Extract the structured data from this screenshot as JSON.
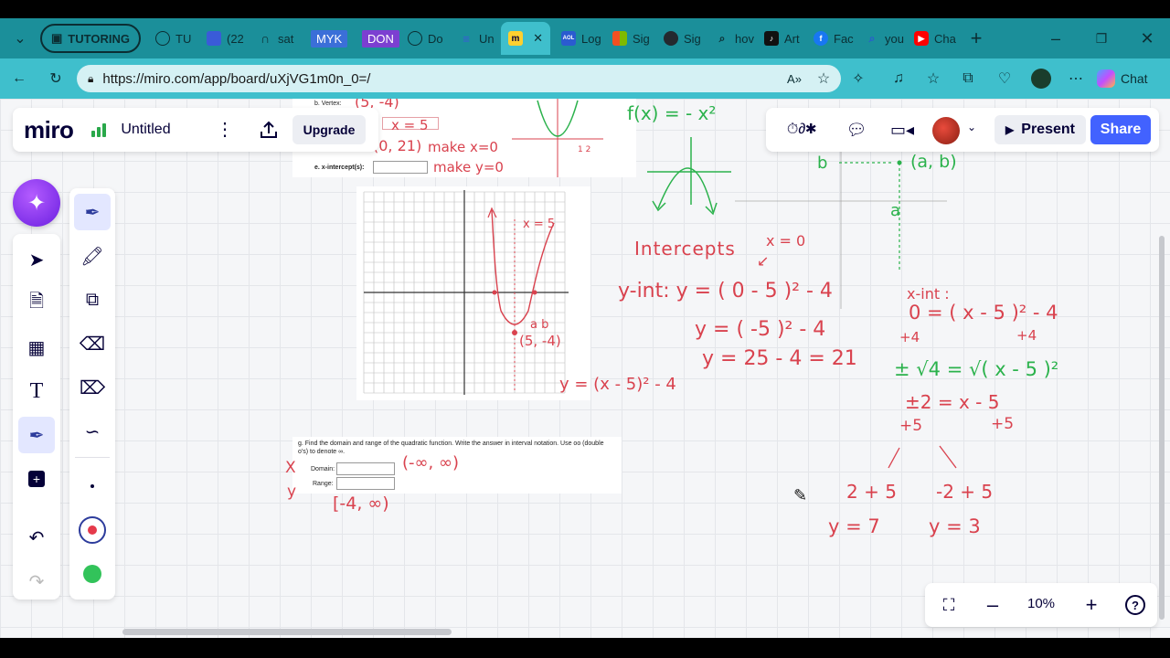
{
  "browser": {
    "tab_group_label": "TUTORING",
    "tabs": [
      {
        "label": "TU",
        "icon": "globe-icon"
      },
      {
        "label": "(22",
        "icon": "mail-icon"
      },
      {
        "label": "sat",
        "icon": "horseshoe-icon"
      },
      {
        "label": "MYK",
        "icon": "badge-icon",
        "color": "#3b6fd8"
      },
      {
        "label": "DON",
        "icon": "badge-icon",
        "color": "#7c3fd1"
      },
      {
        "label": "Do",
        "icon": "globe-icon"
      },
      {
        "label": "Un",
        "icon": "doc-icon"
      },
      {
        "label": "Log",
        "icon": "aol-icon"
      },
      {
        "label": "Sig",
        "icon": "microsoft-icon"
      },
      {
        "label": "Sig",
        "icon": "github-icon"
      },
      {
        "label": "hov",
        "icon": "search-icon"
      },
      {
        "label": "Art",
        "icon": "tiktok-icon"
      },
      {
        "label": "Fac",
        "icon": "facebook-icon"
      },
      {
        "label": "you",
        "icon": "search-icon"
      },
      {
        "label": "Cha",
        "icon": "youtube-icon"
      }
    ],
    "url": "https://miro.com/app/board/uXjVG1m0n_0=/",
    "chat_label": "Chat",
    "new_tab_symbol": "+",
    "close_symbol": "✕"
  },
  "board": {
    "logo": "miro",
    "name": "Untitled",
    "upgrade_label": "Upgrade",
    "present_label": "Present",
    "share_label": "Share",
    "zoom": "10%"
  },
  "worksheet": {
    "vertex_label": "b.  Vertex:",
    "x_intercept_label": "e.  x-intercept(s):",
    "question_g": "g.   Find the domain and range of the quadratic function. Write the answer in interval notation. Use oo (double o's) to denote ∞.",
    "domain_label": "Domain:",
    "range_label": "Range:"
  },
  "handwriting": {
    "vertex_answer": "(5, -4)",
    "axis_answer": "x = 5",
    "y_int_answer": "(0, 21)",
    "make_x0": "make x=0",
    "make_y0": "make y=0",
    "fx_green": "f(x) = - x²",
    "ab_label": "(a, b)",
    "b_label": "b",
    "a_label": "a",
    "intercepts": "Intercepts",
    "x_eq_0": "x = 0",
    "y_int_line1": "y-int:  y = ( 0 - 5 )² - 4",
    "y_int_line2": "y = ( -5 )² - 4",
    "y_int_line3": "y = 25 - 4 = 21",
    "x_int_label": "x-int :",
    "x_int_line1": "0 = ( x - 5 )² - 4",
    "x_int_plus4a": "+4",
    "x_int_plus4b": "+4",
    "x_int_line2": "± √4 = √( x - 5 )²",
    "x_int_line3": "±2 = x - 5",
    "x_int_plus5a": "+5",
    "x_int_plus5b": "+5",
    "left_branch": "2 + 5",
    "right_branch": "-2 + 5",
    "left_result": "y = 7",
    "right_result": "y = 3",
    "graph_eq": "y = (x - 5)² - 4",
    "graph_x5": "x = 5",
    "graph_ab": "a  b",
    "graph_vertex": "(5, -4)",
    "domain_answer": "(-∞, ∞)",
    "range_answer": "[-4, ∞)",
    "x_letter": "X",
    "y_letter": "y"
  }
}
